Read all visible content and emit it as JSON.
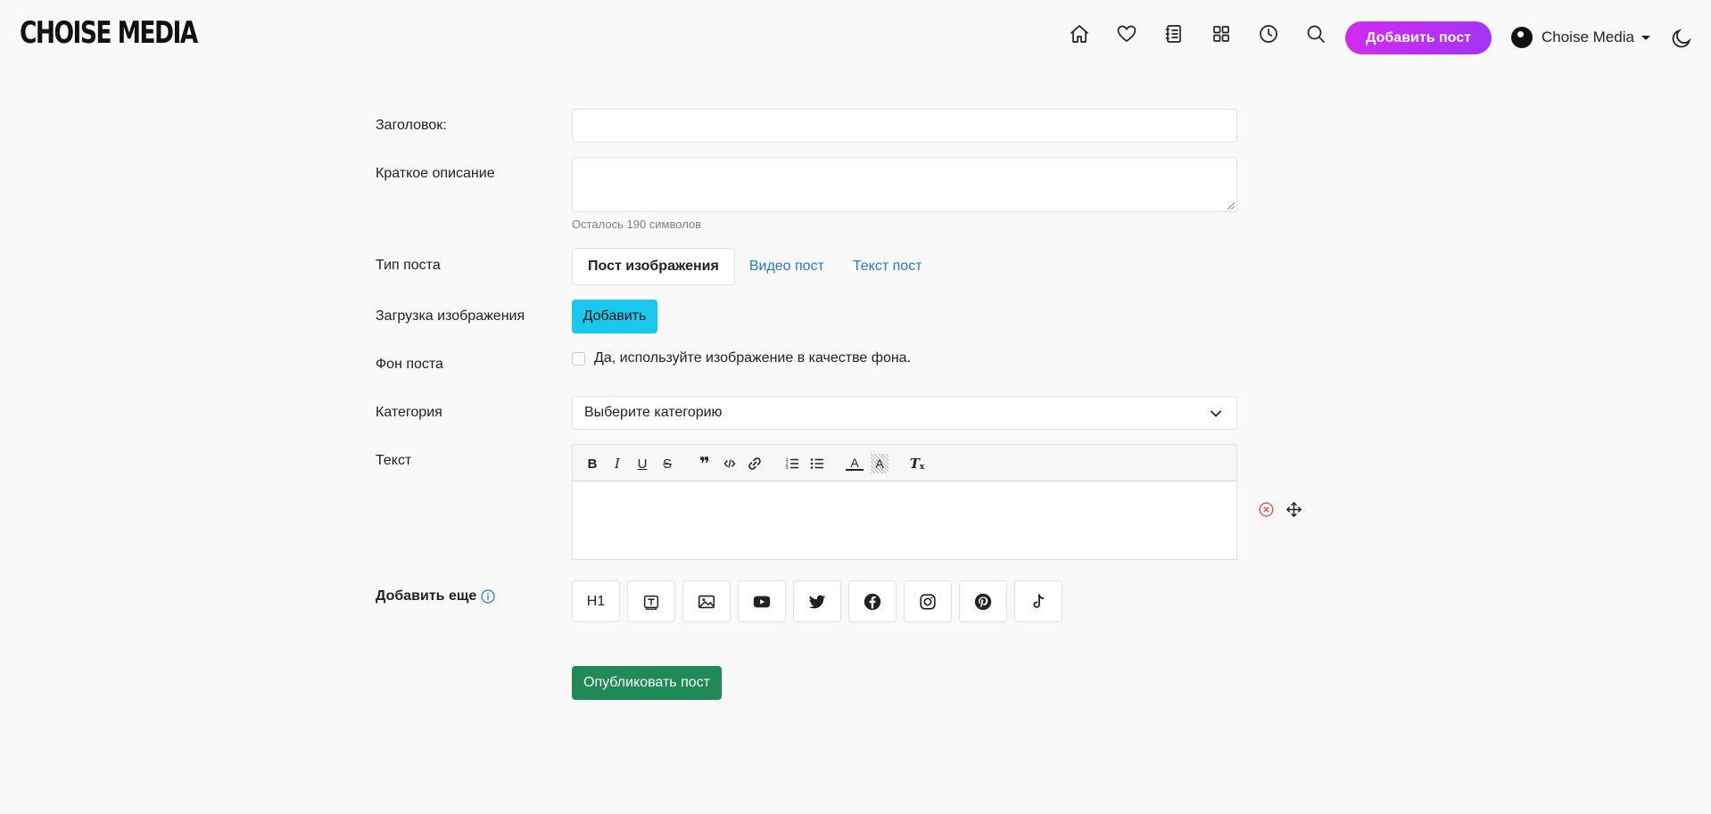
{
  "brand": {
    "logo": "CHOISE MEDIA"
  },
  "header": {
    "add_post_label": "Добавить пост",
    "user_name": "Choise Media"
  },
  "form": {
    "title_label": "Заголовок:",
    "title_value": "",
    "description_label": "Краткое описание",
    "description_value": "",
    "chars_left": "Осталось 190 символов",
    "post_type_label": "Тип поста",
    "post_types": [
      "Пост изображения",
      "Видео пост",
      "Текст пост"
    ],
    "image_upload_label": "Загрузка изображения",
    "upload_button": "Добавить",
    "background_label": "Фон поста",
    "background_checkbox": "Да, используйте изображение в качестве фона.",
    "category_label": "Категория",
    "category_selected": "Выберите категорию",
    "text_label": "Текст",
    "add_more_label": "Добавить еще",
    "heading_block": "H1",
    "publish_button": "Опубликовать пост"
  },
  "colors": {
    "accent_gradient_start": "#d12cf0",
    "accent_gradient_end": "#a433f5",
    "upload_button": "#19c8ec",
    "publish_button": "#1f8a56",
    "link": "#1f7ad0"
  }
}
